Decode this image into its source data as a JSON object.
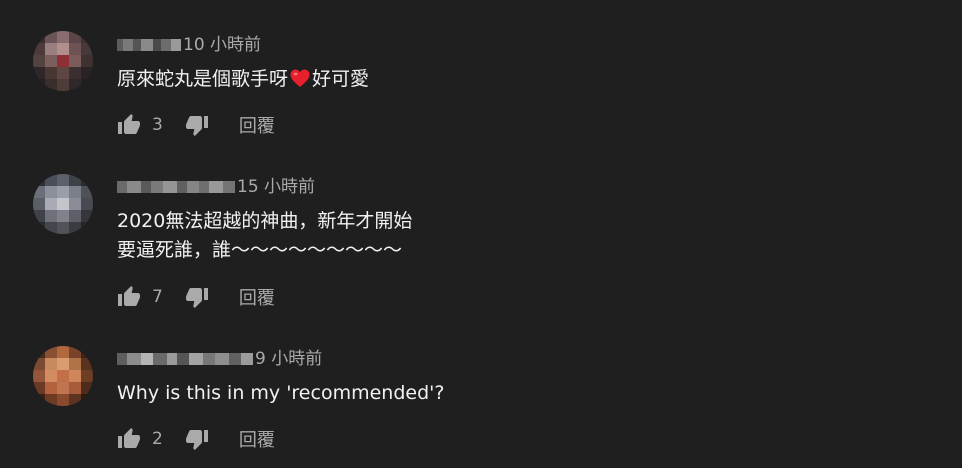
{
  "comments": [
    {
      "timestamp": "10 小時前",
      "text_before": "原來蛇丸是個歌手呀",
      "text_after": "好可愛",
      "likes": "3",
      "reply_label": "回覆"
    },
    {
      "timestamp": "15 小時前",
      "text_line1": "2020無法超越的神曲，新年才開始",
      "text_line2": "要逼死誰，誰～～～～～～～～～",
      "likes": "7",
      "reply_label": "回覆"
    },
    {
      "timestamp": "9 小時前",
      "text": "Why is this in my 'recommended'?",
      "likes": "2",
      "reply_label": "回覆"
    }
  ],
  "colors": {
    "background": "#1f1f1f",
    "text": "#f1f1f1",
    "secondary": "#aaaaaa",
    "heart": "#e8202d"
  },
  "icons": [
    "thumbs-up-icon",
    "thumbs-down-icon",
    "red-heart-emoji"
  ]
}
